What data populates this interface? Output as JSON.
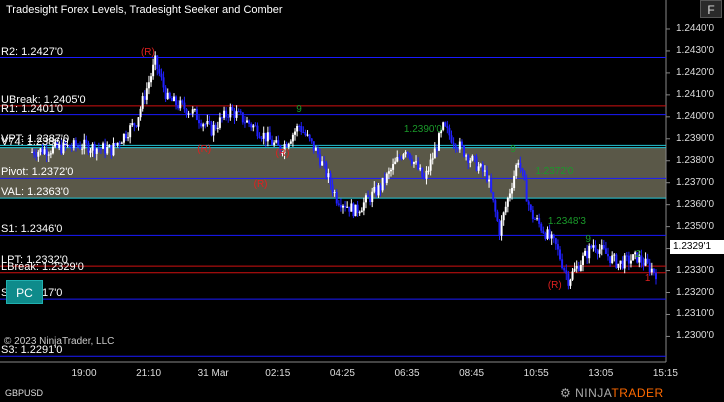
{
  "window": {
    "title": "Tradesight Forex Levels, Tradesight Seeker and Comber",
    "f_button": "F",
    "pc_button": "PC",
    "copyright": "© 2023 NinjaTrader, LLC",
    "symbol": "GBPUSD",
    "logo_prefix": "NINJA",
    "logo_suffix": "TRADER",
    "current_price": "1.2329'1"
  },
  "colors": {
    "background": "#000000",
    "level_blue": "#1a1aff",
    "level_red": "#d01010",
    "level_cyan": "#25c8d8",
    "value_area_fill": "#5a5848",
    "bar_up": "#ffffff",
    "bar_down": "#2020ff",
    "seeker_green": "#1a9a2a",
    "comber_red": "#e02020"
  },
  "levels": [
    {
      "label": "R2: 1.2427'0",
      "price": 1.2427,
      "color": "blue"
    },
    {
      "label": "UBreak: 1.2405'0",
      "price": 1.2405,
      "color": "red"
    },
    {
      "label": "R1: 1.2401'0",
      "price": 1.2401,
      "color": "blue"
    },
    {
      "label": "VPT: 1.2387'0",
      "price": 1.2387,
      "color": "cyan"
    },
    {
      "label": "V74: 1.2386'0",
      "price": 1.2386,
      "color": "cyan"
    },
    {
      "label": "Pivot: 1.2372'0",
      "price": 1.2372,
      "color": "blue"
    },
    {
      "label": "VAL: 1.2363'0",
      "price": 1.2363,
      "color": "cyan"
    },
    {
      "label": "S1: 1.2346'0",
      "price": 1.2346,
      "color": "blue"
    },
    {
      "label": "LPT: 1.2332'0",
      "price": 1.2332,
      "color": "red"
    },
    {
      "label": "LBreak: 1.2329'0",
      "price": 1.2329,
      "color": "red"
    },
    {
      "label": "S2: 1.2317'0",
      "price": 1.2317,
      "color": "blue"
    },
    {
      "label": "S3: 1.2291'0",
      "price": 1.2291,
      "color": "blue"
    }
  ],
  "annotations": [
    {
      "text": "(R)",
      "color": "red",
      "t": 0.19,
      "price": 1.2429
    },
    {
      "text": "1.2390'0",
      "color": "green",
      "t": 0.61,
      "price": 1.2394
    },
    {
      "text": "1.2372'0",
      "color": "green",
      "t": 0.82,
      "price": 1.2375
    },
    {
      "text": "1.2348'3",
      "color": "green",
      "t": 0.84,
      "price": 1.2352
    },
    {
      "text": "(R)",
      "color": "red",
      "t": 0.28,
      "price": 1.2385
    },
    {
      "text": "(R)",
      "color": "red",
      "t": 0.405,
      "price": 1.2383
    },
    {
      "text": "(R)",
      "color": "red",
      "t": 0.37,
      "price": 1.2369
    },
    {
      "text": "(R)",
      "color": "red",
      "t": 0.84,
      "price": 1.2323
    },
    {
      "text": "1",
      "color": "red",
      "t": 0.995,
      "price": 1.2326
    },
    {
      "text": "9",
      "color": "green",
      "t": 0.438,
      "price": 1.2403
    },
    {
      "text": "9",
      "color": "green",
      "t": 0.78,
      "price": 1.2385
    },
    {
      "text": "9",
      "color": "green",
      "t": 0.9,
      "price": 1.2344
    },
    {
      "text": "2",
      "color": "green",
      "t": 0.98,
      "price": 1.2337
    }
  ],
  "chart_data": {
    "type": "candlestick",
    "title": "Tradesight Forex Levels, Tradesight Seeker and Comber",
    "symbol": "GBPUSD",
    "x_tick_labels": [
      "19:00",
      "21:10",
      "31 Mar",
      "02:15",
      "04:25",
      "06:35",
      "08:45",
      "10:55",
      "13:05",
      "15:15"
    ],
    "y_tick_labels": [
      "1.2440'0",
      "1.2430'0",
      "1.2420'0",
      "1.2410'0",
      "1.2400'0",
      "1.2390'0",
      "1.2380'0",
      "1.2370'0",
      "1.2360'0",
      "1.2350'0",
      "1.2340'0",
      "1.2330'0",
      "1.2320'0",
      "1.2310'0",
      "1.2300'0"
    ],
    "y_ticks": [
      1.244,
      1.243,
      1.242,
      1.241,
      1.24,
      1.239,
      1.238,
      1.237,
      1.236,
      1.235,
      1.234,
      1.233,
      1.232,
      1.231,
      1.23
    ],
    "ylim": [
      1.2292,
      1.2445
    ],
    "value_area": [
      1.2363,
      1.2386
    ],
    "path_anchors": [
      {
        "t": 0.0,
        "price": 1.2384
      },
      {
        "t": 0.08,
        "price": 1.2387
      },
      {
        "t": 0.13,
        "price": 1.2385
      },
      {
        "t": 0.17,
        "price": 1.2398
      },
      {
        "t": 0.2,
        "price": 1.2425
      },
      {
        "t": 0.22,
        "price": 1.2408
      },
      {
        "t": 0.26,
        "price": 1.2402
      },
      {
        "t": 0.29,
        "price": 1.2394
      },
      {
        "t": 0.32,
        "price": 1.2403
      },
      {
        "t": 0.36,
        "price": 1.2395
      },
      {
        "t": 0.4,
        "price": 1.2385
      },
      {
        "t": 0.43,
        "price": 1.2396
      },
      {
        "t": 0.46,
        "price": 1.2383
      },
      {
        "t": 0.49,
        "price": 1.2363
      },
      {
        "t": 0.52,
        "price": 1.2357
      },
      {
        "t": 0.56,
        "price": 1.2368
      },
      {
        "t": 0.6,
        "price": 1.2386
      },
      {
        "t": 0.63,
        "price": 1.2371
      },
      {
        "t": 0.66,
        "price": 1.2395
      },
      {
        "t": 0.7,
        "price": 1.2382
      },
      {
        "t": 0.73,
        "price": 1.2373
      },
      {
        "t": 0.75,
        "price": 1.2348
      },
      {
        "t": 0.78,
        "price": 1.2381
      },
      {
        "t": 0.8,
        "price": 1.2356
      },
      {
        "t": 0.84,
        "price": 1.2341
      },
      {
        "t": 0.86,
        "price": 1.2326
      },
      {
        "t": 0.9,
        "price": 1.2342
      },
      {
        "t": 0.94,
        "price": 1.2333
      },
      {
        "t": 0.97,
        "price": 1.2336
      },
      {
        "t": 1.0,
        "price": 1.2329
      }
    ],
    "last_price": 1.23291
  }
}
